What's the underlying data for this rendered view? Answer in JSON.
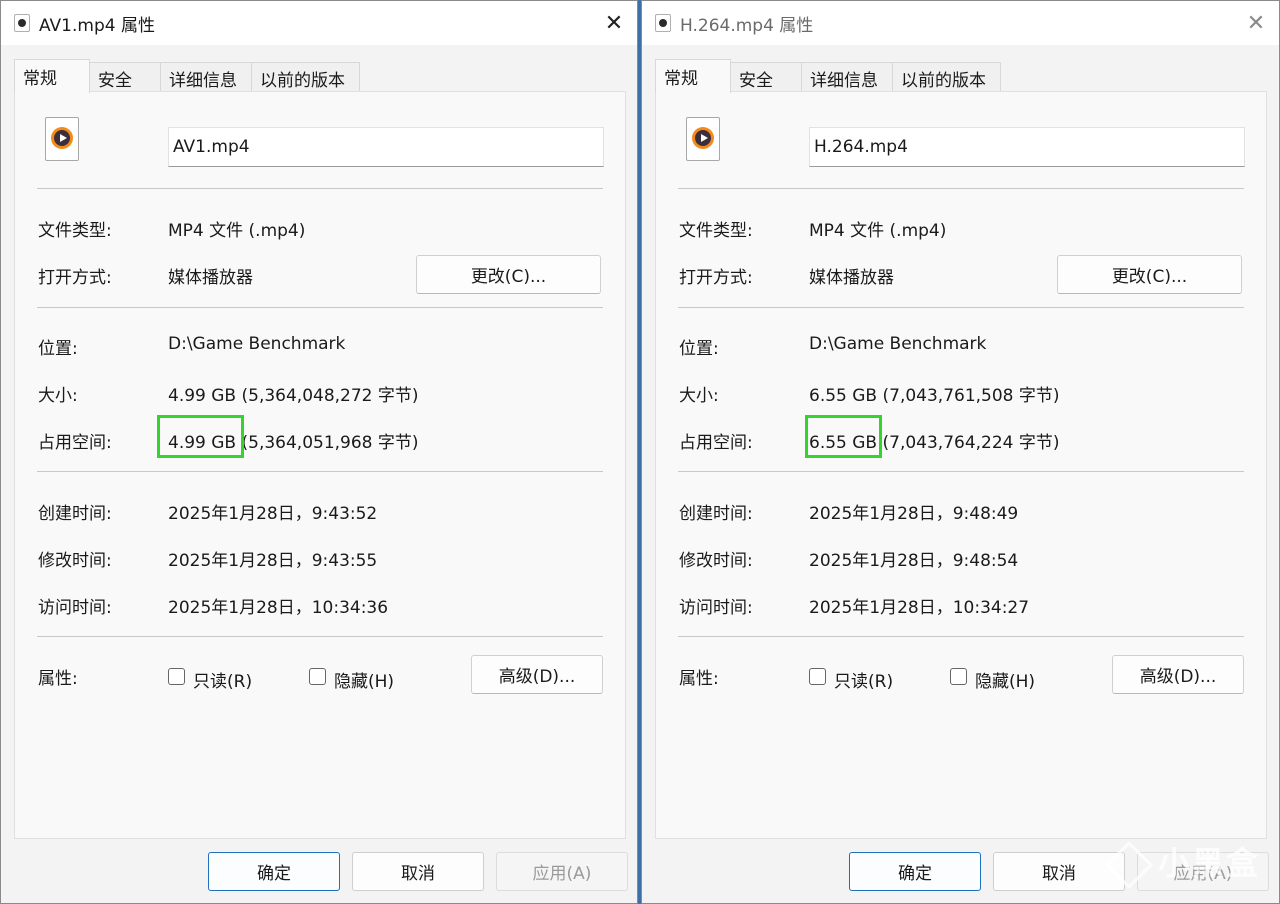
{
  "dialogs": [
    {
      "title": "AV1.mp4 属性",
      "tabs": [
        "常规",
        "安全",
        "详细信息",
        "以前的版本"
      ],
      "filename": "AV1.mp4",
      "type_label": "文件类型:",
      "type_value": "MP4 文件 (.mp4)",
      "open_label": "打开方式:",
      "open_value": "媒体播放器",
      "change_button": "更改(C)...",
      "location_label": "位置:",
      "location_value": "D:\\Game Benchmark",
      "size_label": "大小:",
      "size_value": "4.99 GB (5,364,048,272 字节)",
      "disk_label": "占用空间:",
      "disk_value_short": "4.99 GB",
      "disk_value_rest": "(5,364,051,968 字节)",
      "created_label": "创建时间:",
      "created_value": "2025年1月28日，9:43:52",
      "modified_label": "修改时间:",
      "modified_value": "2025年1月28日，9:43:55",
      "accessed_label": "访问时间:",
      "accessed_value": "2025年1月28日，10:34:36",
      "attrs_label": "属性:",
      "readonly_label": "只读(R)",
      "hidden_label": "隐藏(H)",
      "advanced_button": "高级(D)...",
      "ok_button": "确定",
      "cancel_button": "取消",
      "apply_button": "应用(A)"
    },
    {
      "title": "H.264.mp4 属性",
      "tabs": [
        "常规",
        "安全",
        "详细信息",
        "以前的版本"
      ],
      "filename": "H.264.mp4",
      "type_label": "文件类型:",
      "type_value": "MP4 文件 (.mp4)",
      "open_label": "打开方式:",
      "open_value": "媒体播放器",
      "change_button": "更改(C)...",
      "location_label": "位置:",
      "location_value": "D:\\Game Benchmark",
      "size_label": "大小:",
      "size_value": "6.55 GB (7,043,761,508 字节)",
      "disk_label": "占用空间:",
      "disk_value_short": "6.55 GB",
      "disk_value_rest": "(7,043,764,224 字节)",
      "created_label": "创建时间:",
      "created_value": "2025年1月28日，9:48:49",
      "modified_label": "修改时间:",
      "modified_value": "2025年1月28日，9:48:54",
      "accessed_label": "访问时间:",
      "accessed_value": "2025年1月28日，10:34:27",
      "attrs_label": "属性:",
      "readonly_label": "只读(R)",
      "hidden_label": "隐藏(H)",
      "advanced_button": "高级(D)...",
      "ok_button": "确定",
      "cancel_button": "取消",
      "apply_button": "应用(A)"
    }
  ],
  "watermark": "小黑盒",
  "colors": {
    "highlight": "#35d42d",
    "primary_border": "#1f6fbf"
  }
}
